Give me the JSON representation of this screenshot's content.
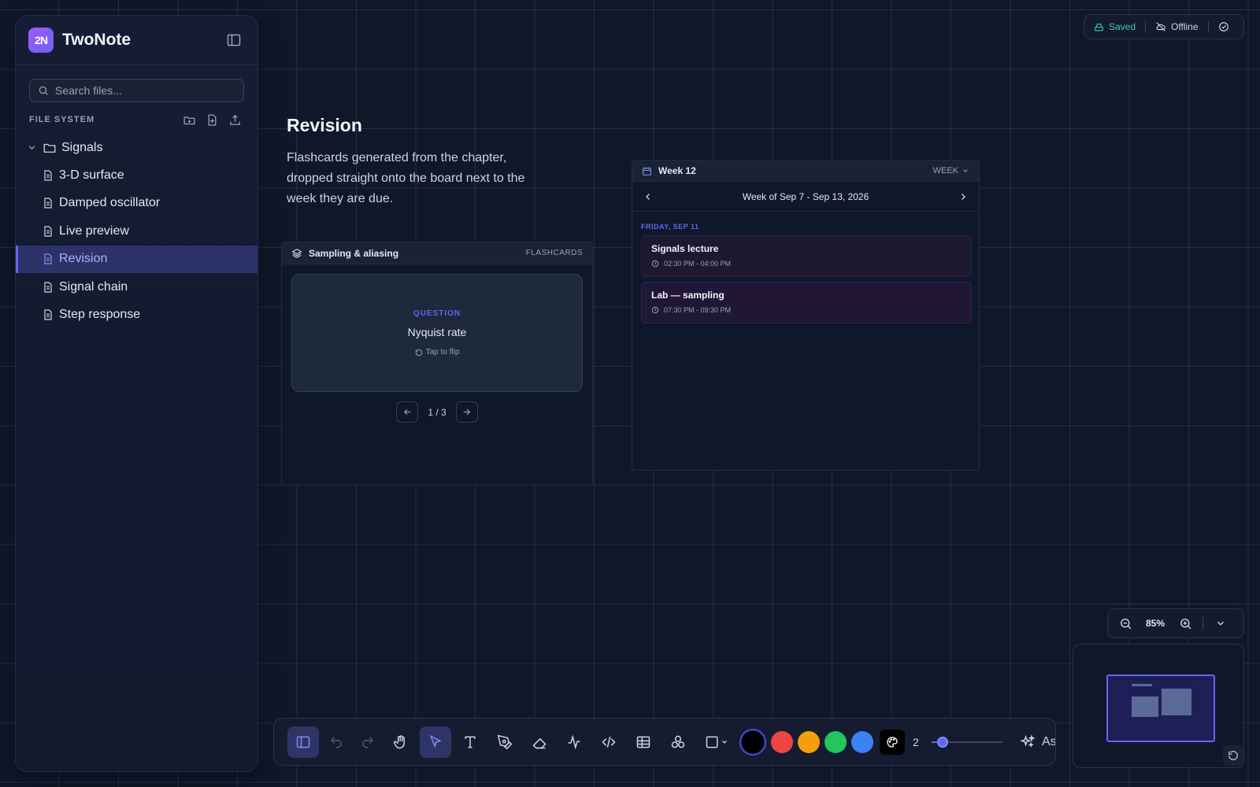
{
  "sidebar": {
    "logo_text": "2N",
    "app_title": "TwoNote",
    "search_placeholder": "Search files...",
    "section_label": "FILE SYSTEM",
    "folder": {
      "name": "Signals",
      "expanded": true
    },
    "files": [
      {
        "label": "3-D surface",
        "active": false
      },
      {
        "label": "Damped oscillator",
        "active": false
      },
      {
        "label": "Live preview",
        "active": false
      },
      {
        "label": "Revision",
        "active": true
      },
      {
        "label": "Signal chain",
        "active": false
      },
      {
        "label": "Step response",
        "active": false
      }
    ]
  },
  "status": {
    "saved": "Saved",
    "offline": "Offline"
  },
  "canvas": {
    "title": "Revision",
    "description": "Flashcards generated from the chapter, dropped straight onto the board next to the week they are due."
  },
  "flashcards": {
    "title": "Sampling & aliasing",
    "tag": "FLASHCARDS",
    "card_label": "QUESTION",
    "card_term": "Nyquist rate",
    "flip_hint": "Tap to flip",
    "page": "1 / 3"
  },
  "calendar": {
    "title": "Week 12",
    "view": "WEEK",
    "range": "Week of Sep 7 - Sep 13, 2026",
    "day_label": "FRIDAY, SEP 11",
    "events": [
      {
        "title": "Signals lecture",
        "time": "02:30 PM - 04:00 PM"
      },
      {
        "title": "Lab — sampling",
        "time": "07:30 PM - 09:30 PM"
      }
    ]
  },
  "zoom": {
    "level": "85%"
  },
  "toolbar": {
    "tools": [
      "sidebar-toggle",
      "undo",
      "redo",
      "hand",
      "select",
      "text",
      "pen",
      "eraser",
      "pulse",
      "code",
      "table",
      "components",
      "shape"
    ],
    "active_tool": "select",
    "colors": [
      "#000000",
      "#ef4444",
      "#f59e0b",
      "#22c55e",
      "#3b82f6"
    ],
    "selected_color": "#000000",
    "stroke_width": "2",
    "stroke_level": 0.15,
    "ai_label": "As"
  },
  "theme": {
    "accent": "#6366f1",
    "saved_color": "#34d399"
  }
}
